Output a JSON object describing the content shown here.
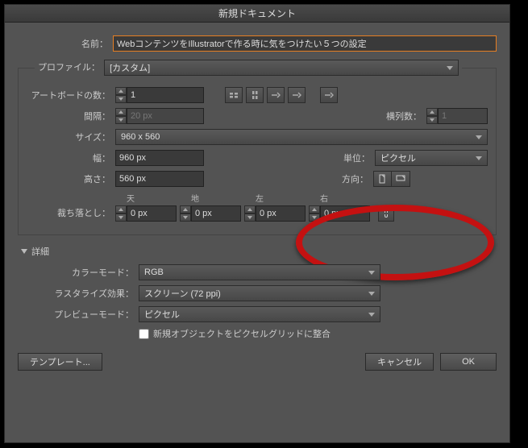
{
  "title": "新規ドキュメント",
  "name": {
    "label": "名前：",
    "value": "WebコンテンツをIllustratorで作る時に気をつけたい５つの設定"
  },
  "profile": {
    "label": "プロファイル：",
    "value": "[カスタム]"
  },
  "artboards": {
    "label": "アートボードの数：",
    "value": "1"
  },
  "spacing": {
    "label": "間隔：",
    "value": "20 px"
  },
  "columns": {
    "label": "横列数：",
    "value": "1"
  },
  "size": {
    "label": "サイズ：",
    "value": "960 x 560"
  },
  "width": {
    "label": "幅：",
    "value": "960 px"
  },
  "height": {
    "label": "高さ：",
    "value": "560 px"
  },
  "units": {
    "label": "単位：",
    "value": "ピクセル"
  },
  "orientation": {
    "label": "方向："
  },
  "bleed": {
    "label": "裁ち落とし：",
    "top": {
      "label": "天",
      "value": "0 px"
    },
    "bottom": {
      "label": "地",
      "value": "0 px"
    },
    "left": {
      "label": "左",
      "value": "0 px"
    },
    "right": {
      "label": "右",
      "value": "0 px"
    }
  },
  "advanced": {
    "label": "詳細",
    "colorMode": {
      "label": "カラーモード：",
      "value": "RGB"
    },
    "raster": {
      "label": "ラスタライズ効果：",
      "value": "スクリーン (72 ppi)"
    },
    "preview": {
      "label": "プレビューモード：",
      "value": "ピクセル"
    },
    "alignGrid": {
      "label": "新規オブジェクトをピクセルグリッドに整合",
      "checked": false
    }
  },
  "buttons": {
    "template": "テンプレート...",
    "cancel": "キャンセル",
    "ok": "OK"
  }
}
